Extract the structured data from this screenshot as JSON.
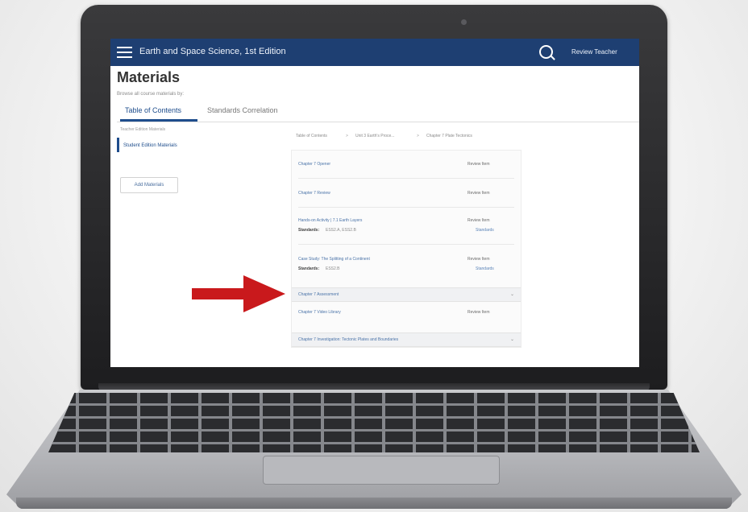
{
  "header": {
    "app_title": "Earth and Space Science, 1st Edition",
    "search_icon": "search-icon",
    "user_name": "Review Teacher"
  },
  "page": {
    "title": "Materials",
    "browse_label": "Browse all course materials by:"
  },
  "tabs": [
    {
      "label": "Table of Contents",
      "active": true
    },
    {
      "label": "Standards Correlation",
      "active": false
    }
  ],
  "sidebar": {
    "prev_item": "Teacher Edition Materials",
    "current_item": "Student Edition Materials",
    "add_button": "Add Materials"
  },
  "breadcrumb": {
    "items": [
      "Table of Contents",
      "Unit 3 Earth's Proce...",
      "Chapter 7 Plate Tectonics"
    ],
    "separator": ">"
  },
  "content": {
    "rows": [
      {
        "title": "Chapter 7 Opener",
        "action": "Review Item"
      },
      {
        "title": "Chapter 7 Review",
        "action": "Review Item"
      },
      {
        "title": "Hands-on Activity | 7.1 Earth Layers",
        "action": "Review Item",
        "standards_label": "Standards:",
        "standards_value": "ESS2.A, ESS2.B",
        "link": "Standards"
      },
      {
        "title": "Case Study: The Splitting of a Continent",
        "action": "Review Item",
        "standards_label": "Standards:",
        "standards_value": "ESS2.B",
        "link": "Standards"
      }
    ],
    "group_assessment": {
      "label": "Chapter 7 Assessment",
      "chevron": "chevron-down-icon"
    },
    "row_after_group": {
      "title": "Chapter 7 Video Library",
      "action": "Review Item"
    },
    "group_investigation": {
      "label": "Chapter 7 Investigation: Tectonic Plates and Boundaries",
      "chevron": "chevron-down-icon"
    }
  },
  "colors": {
    "header_bg": "#1e3f72",
    "accent": "#1e4d8c",
    "arrow": "#c9191c"
  }
}
